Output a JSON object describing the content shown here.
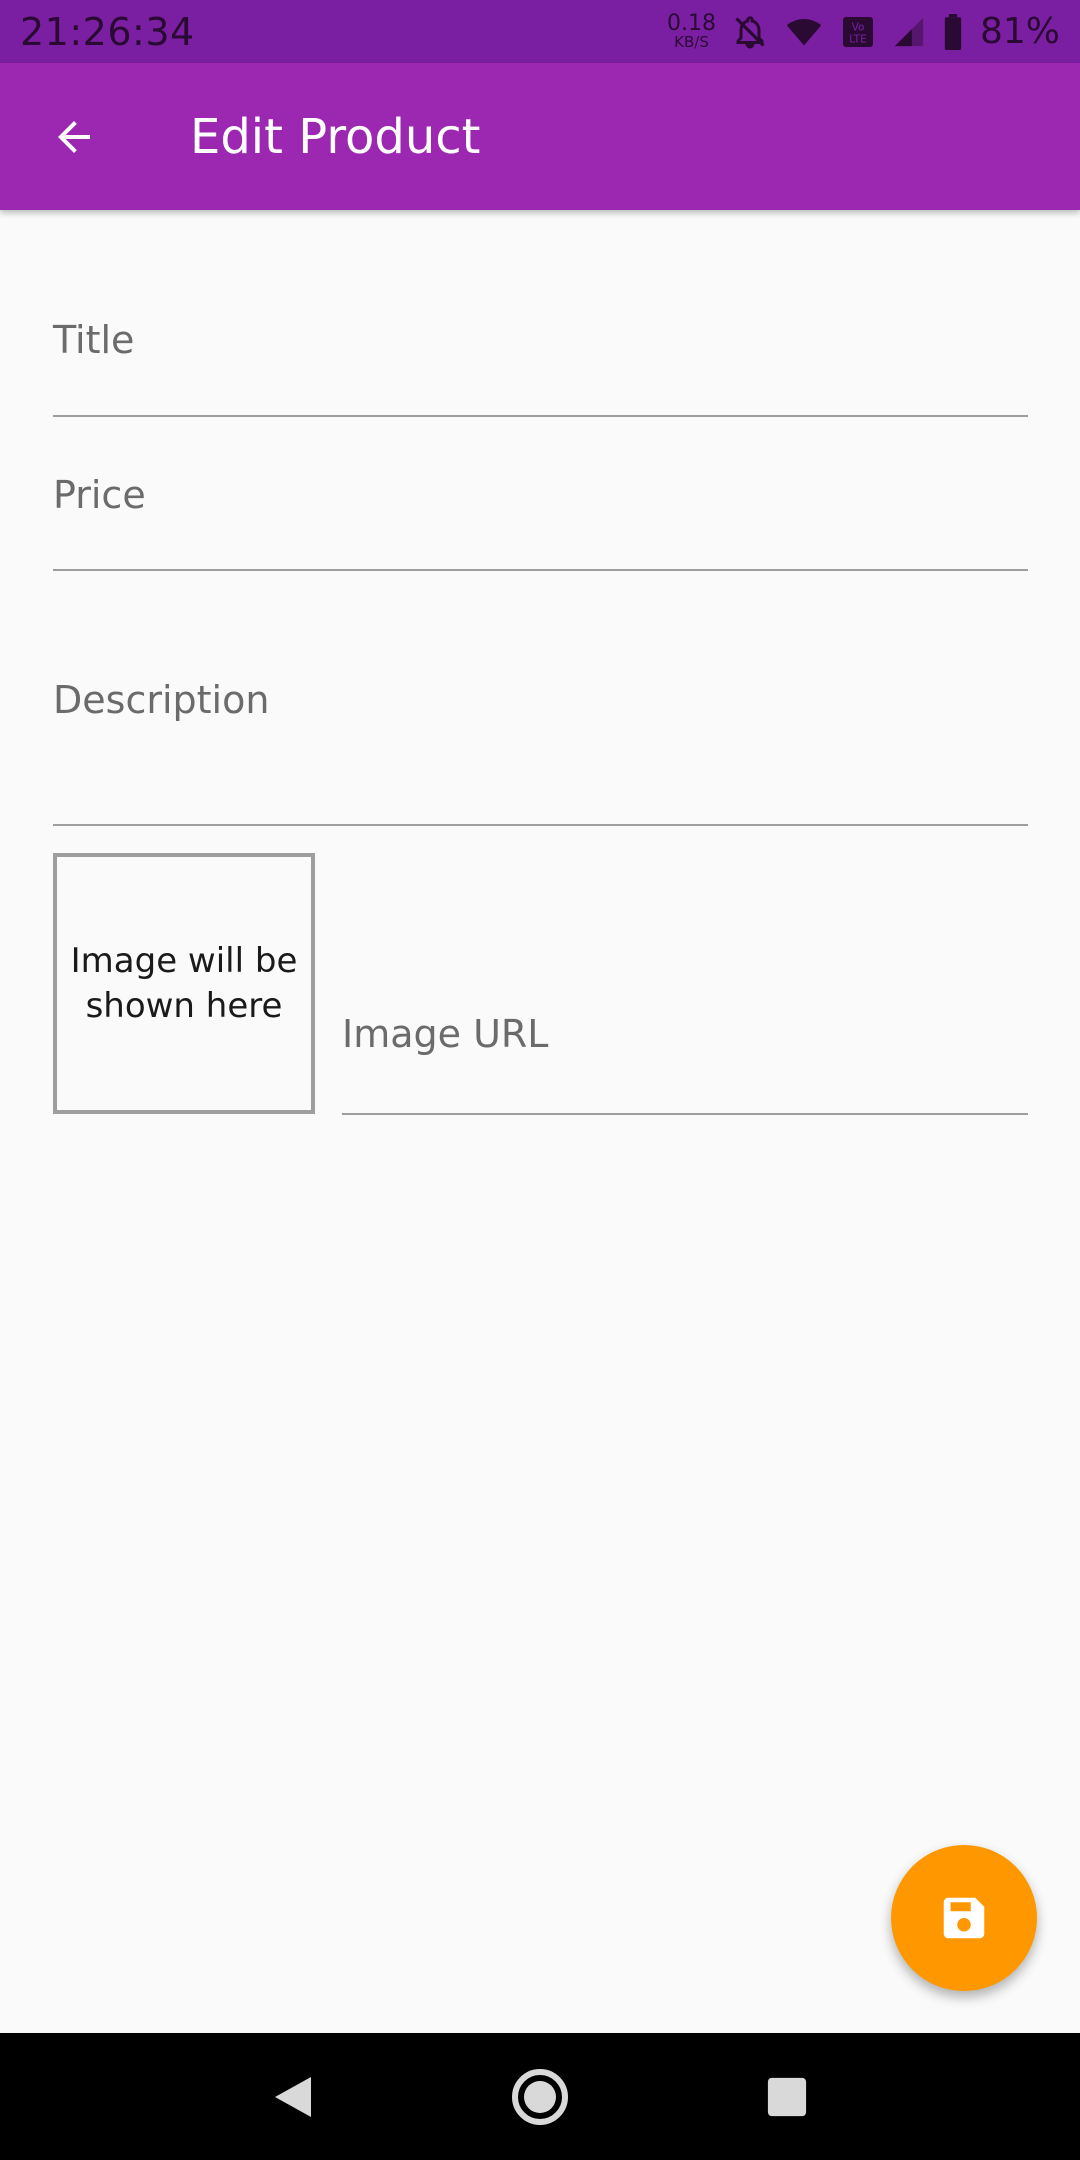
{
  "status_bar": {
    "time": "21:26:34",
    "net_speed_value": "0.18",
    "net_speed_unit": "KB/S",
    "battery_percent": "81%",
    "icons": [
      "bell-off-icon",
      "wifi-icon",
      "volte-icon",
      "signal-icon",
      "battery-icon"
    ]
  },
  "app_bar": {
    "title": "Edit Product",
    "back_icon": "arrow-back-icon",
    "color": "#9c27b0"
  },
  "form": {
    "title_label": "Title",
    "price_label": "Price",
    "description_label": "Description",
    "image_placeholder": "Image will be shown here",
    "image_url_label": "Image URL"
  },
  "fab": {
    "icon": "save-icon",
    "color": "#ff9800"
  },
  "nav_bar": {
    "icons": [
      "back-triangle-icon",
      "home-circle-icon",
      "recents-square-icon"
    ]
  }
}
